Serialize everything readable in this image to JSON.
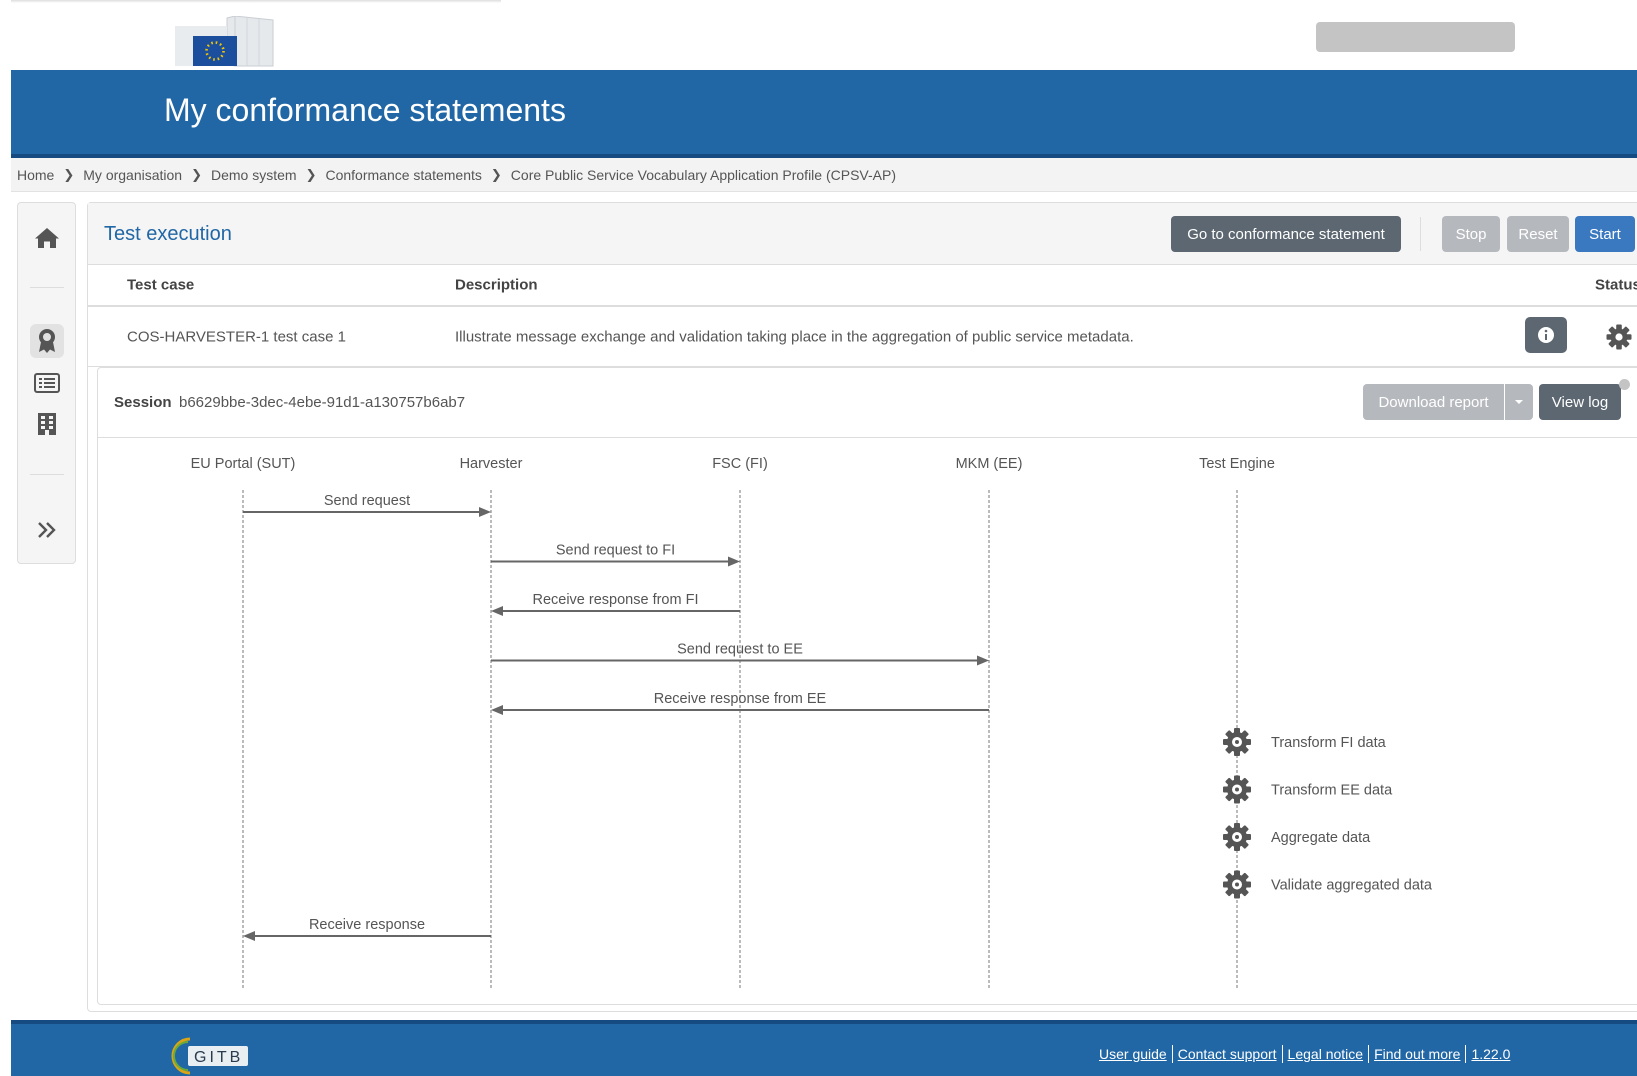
{
  "header": {
    "title": "My conformance statements",
    "logo": "european-commission-logo"
  },
  "breadcrumb": [
    {
      "label": "Home"
    },
    {
      "label": "My organisation"
    },
    {
      "label": "Demo system"
    },
    {
      "label": "Conformance statements"
    },
    {
      "label": "Core Public Service Vocabulary Application Profile (CPSV-AP)"
    }
  ],
  "sidebar": {
    "items": [
      {
        "icon": "home-icon"
      },
      {
        "icon": "conformance-badge-icon"
      },
      {
        "icon": "list-icon"
      },
      {
        "icon": "organisation-building-icon"
      },
      {
        "icon": "expand-chevrons-icon"
      }
    ]
  },
  "execution": {
    "title": "Test execution",
    "buttons": {
      "goto": "Go to conformance statement",
      "stop": "Stop",
      "reset": "Reset",
      "start": "Start"
    },
    "table": {
      "headers": {
        "test_case": "Test case",
        "description": "Description",
        "status": "Status"
      },
      "rows": [
        {
          "test_case": "COS-HARVESTER-1 test case 1",
          "description": "Illustrate message exchange and validation taking place in the aggregation of public service metadata."
        }
      ]
    }
  },
  "session": {
    "label": "Session",
    "id": "b6629bbe-3dec-4ebe-91d1-a130757b6ab7",
    "download_report": "Download report",
    "view_log": "View log"
  },
  "diagram": {
    "actors": [
      "EU Portal (SUT)",
      "Harvester",
      "FSC (FI)",
      "MKM (EE)",
      "Test Engine"
    ],
    "messages": [
      {
        "label": "Send request",
        "from": 0,
        "to": 1
      },
      {
        "label": "Send request to FI",
        "from": 1,
        "to": 2
      },
      {
        "label": "Receive response from FI",
        "from": 2,
        "to": 1
      },
      {
        "label": "Send request to EE",
        "from": 1,
        "to": 3
      },
      {
        "label": "Receive response from EE",
        "from": 3,
        "to": 1
      }
    ],
    "steps": [
      {
        "label": "Transform FI data"
      },
      {
        "label": "Transform EE data"
      },
      {
        "label": "Aggregate data"
      },
      {
        "label": "Validate aggregated data"
      }
    ],
    "final_message": {
      "label": "Receive response",
      "from": 1,
      "to": 0
    }
  },
  "footer": {
    "links": [
      "User guide",
      "Contact support",
      "Legal notice",
      "Find out more",
      "1.22.0"
    ]
  },
  "colors": {
    "brand_blue": "#2167a5",
    "button_dark": "#5c6771",
    "button_disabled": "#b5b9bd",
    "button_primary": "#3a78c0"
  }
}
